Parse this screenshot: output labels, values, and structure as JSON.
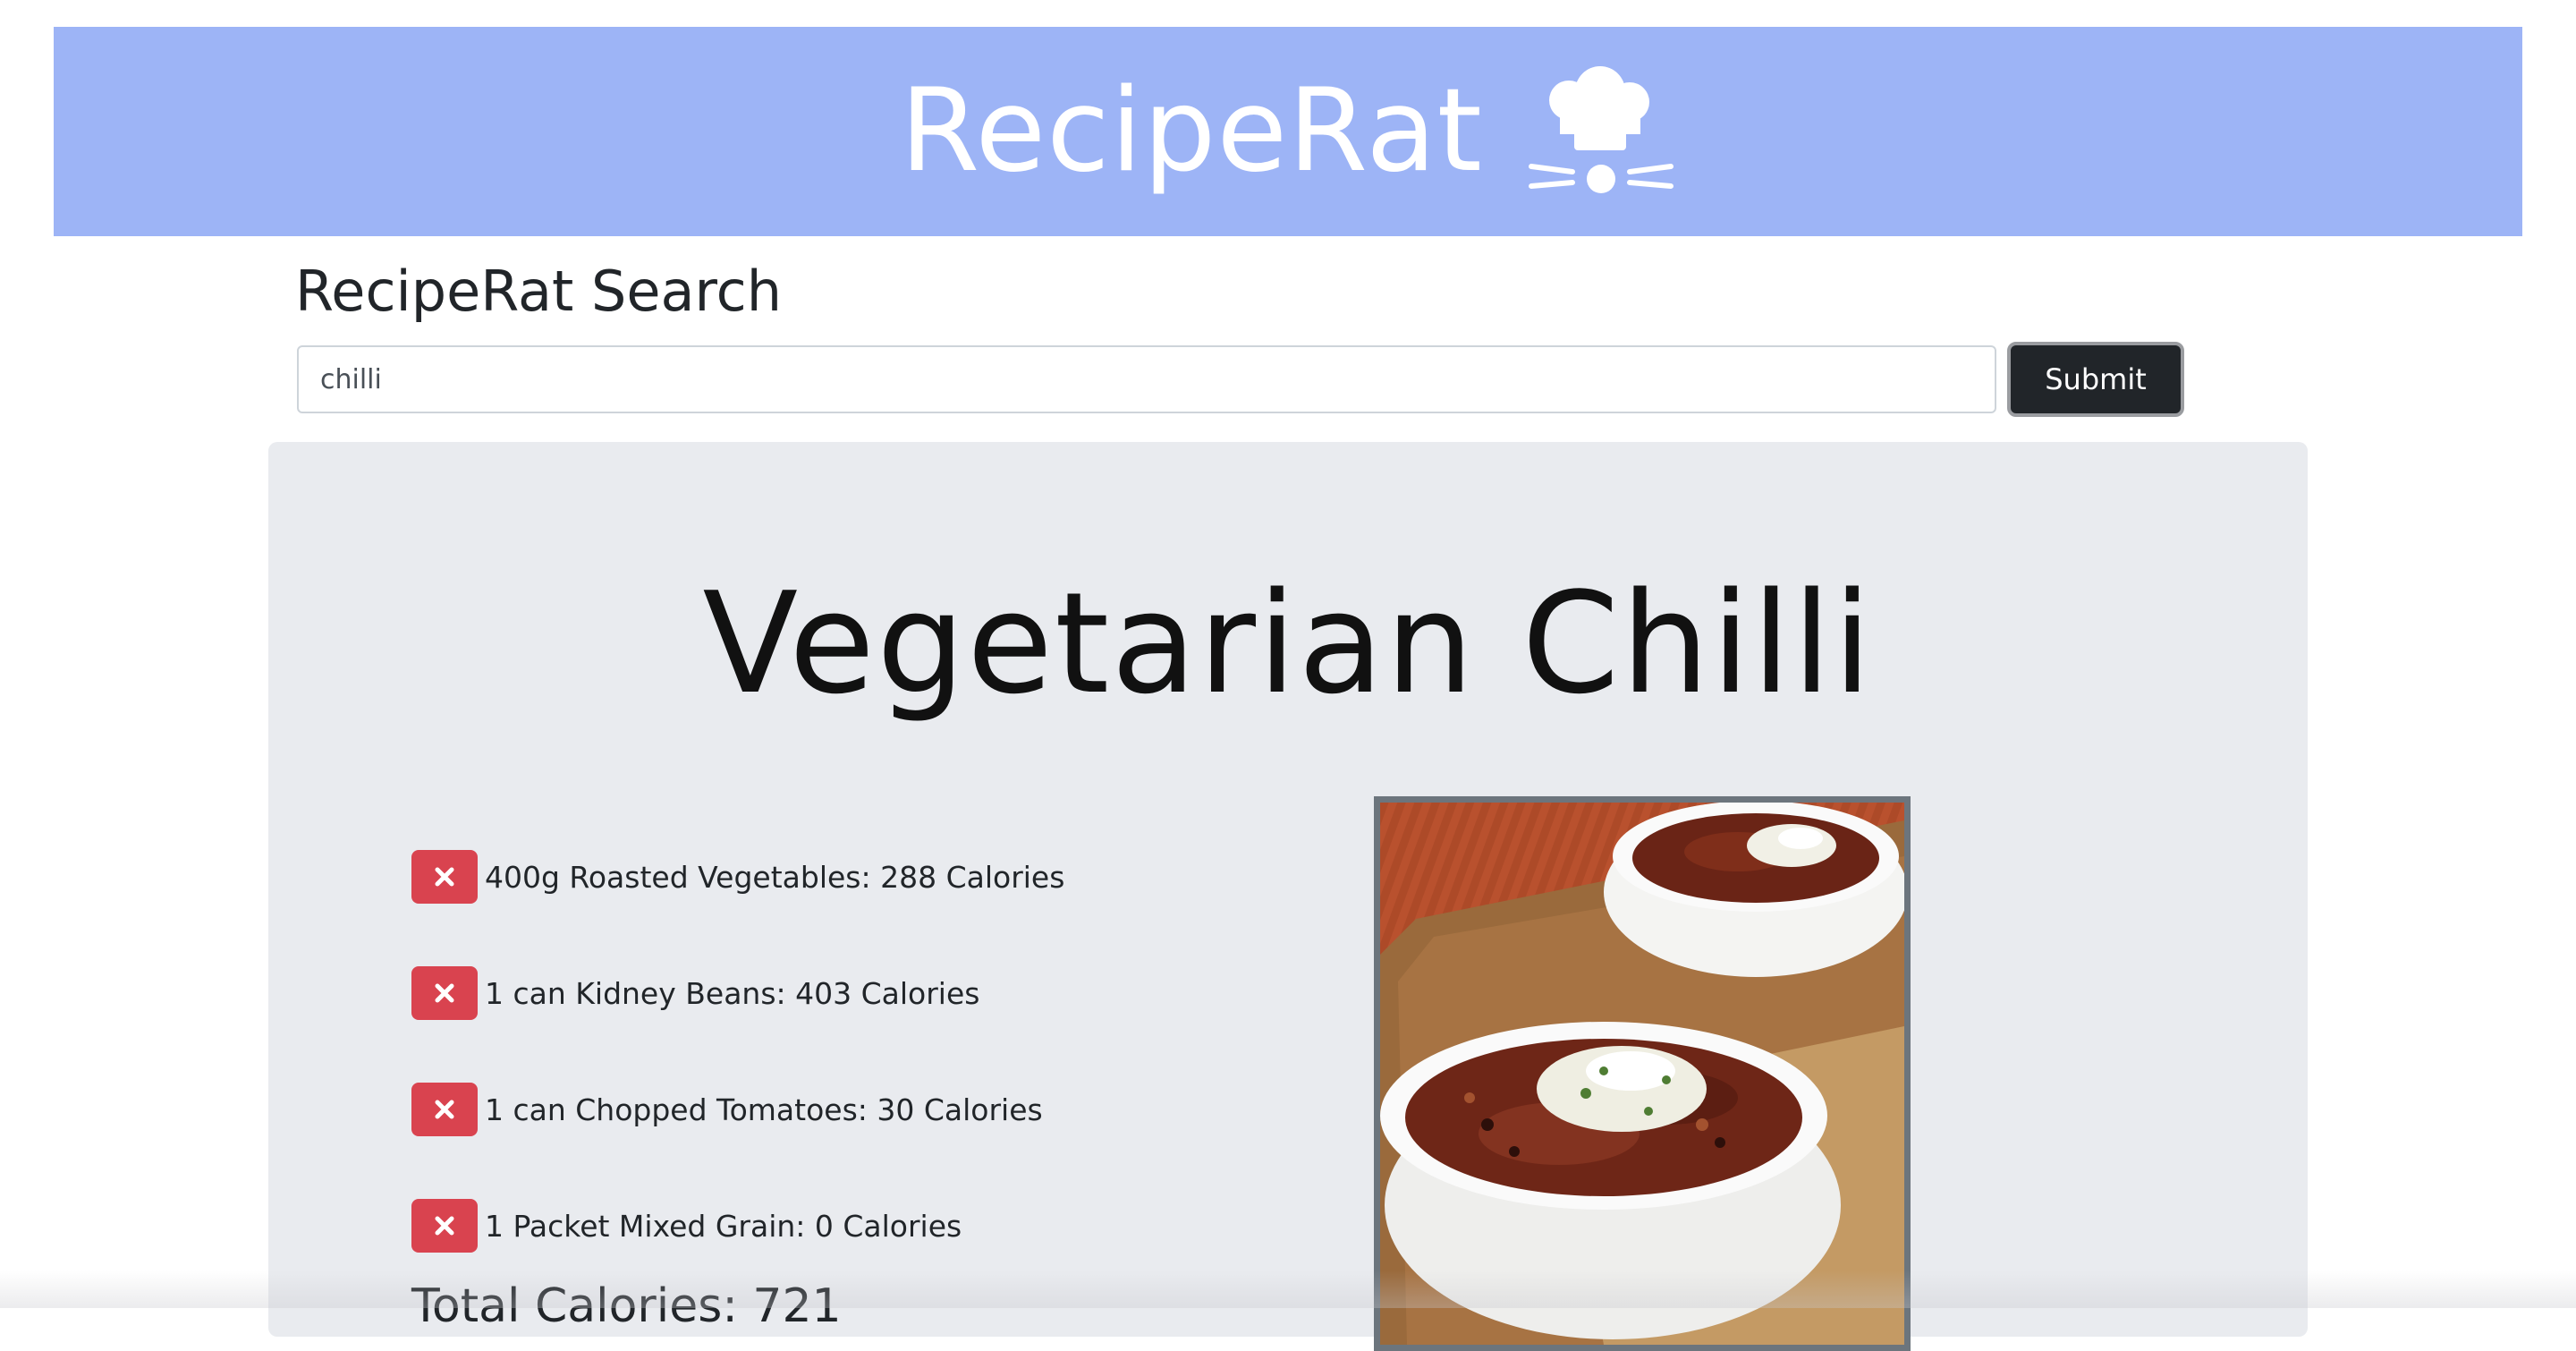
{
  "header": {
    "app_name": "RecipeRat",
    "logo_icon": "rat-chef-hat-icon",
    "background_color": "#9db4f6"
  },
  "search": {
    "title": "RecipeRat Search",
    "input_value": "chilli",
    "submit_label": "Submit"
  },
  "recipe": {
    "title": "Vegetarian Chilli",
    "ingredients": [
      {
        "text": "400g Roasted Vegetables: 288 Calories",
        "remove_icon": "close-icon"
      },
      {
        "text": "1 can Kidney Beans: 403 Calories",
        "remove_icon": "close-icon"
      },
      {
        "text": "1 can Chopped Tomatoes: 30 Calories",
        "remove_icon": "close-icon"
      },
      {
        "text": "1 Packet Mixed Grain: 0 Calories",
        "remove_icon": "close-icon"
      }
    ],
    "total_calories": "Total Calories: 721",
    "image_description": "vegetarian-chilli-photo"
  },
  "colors": {
    "remove_button": "#d9434f",
    "submit_button": "#212529",
    "card_background": "#e9ebef"
  }
}
